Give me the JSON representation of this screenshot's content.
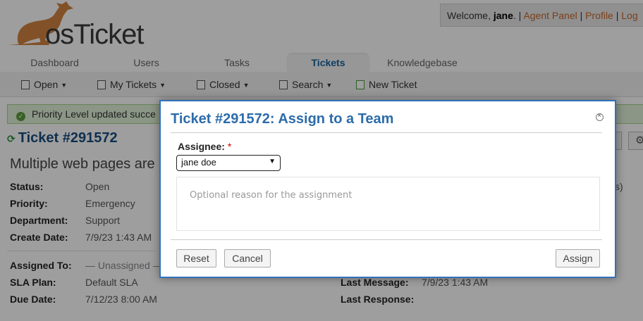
{
  "header": {
    "logo_text": "osTicket",
    "welcome_prefix": "Welcome, ",
    "user_name": "jane",
    "welcome_suffix": ".",
    "links": [
      "Agent Panel",
      "Profile",
      "Log"
    ],
    "separator": " | "
  },
  "nav": {
    "tabs": [
      "Dashboard",
      "Users",
      "Tasks",
      "Tickets",
      "Knowledgebase"
    ],
    "active_tab": "Tickets"
  },
  "subnav": {
    "open": "Open",
    "my_tickets": "My Tickets",
    "closed": "Closed",
    "search": "Search",
    "new_ticket": "New Ticket"
  },
  "alert": {
    "message": "Priority Level updated succe"
  },
  "ticket": {
    "title": "Ticket #291572",
    "subject": "Multiple web pages are",
    "fields": {
      "status_label": "Status:",
      "status_value": "Open",
      "priority_label": "Priority:",
      "priority_value": "Emergency",
      "department_label": "Department:",
      "department_value": "Support",
      "create_label": "Create Date:",
      "create_value": "7/9/23 1:43 AM",
      "assigned_label": "Assigned To:",
      "assigned_value": "— Unassigned —",
      "sla_label": "SLA Plan:",
      "sla_value": "Default SLA",
      "due_label": "Due Date:",
      "due_value": "7/12/23 8:00 AM",
      "last_message_label": "Last Message:",
      "last_message_value": "7/9/23 1:43 AM",
      "last_response_label": "Last Response:",
      "right_fragment": "s)"
    }
  },
  "modal": {
    "title": "Ticket #291572: Assign to a Team",
    "assignee_label": "Assignee:",
    "required_mark": "*",
    "assignee_value": "jane doe",
    "comment_placeholder": "Optional reason for the assignment",
    "reset": "Reset",
    "cancel": "Cancel",
    "assign": "Assign"
  },
  "colors": {
    "brand_orange": "#d2843f",
    "link_orange": "#c7672a",
    "title_blue": "#2c6cab",
    "modal_border": "#3072b8",
    "success_green": "#5c9d3e"
  }
}
